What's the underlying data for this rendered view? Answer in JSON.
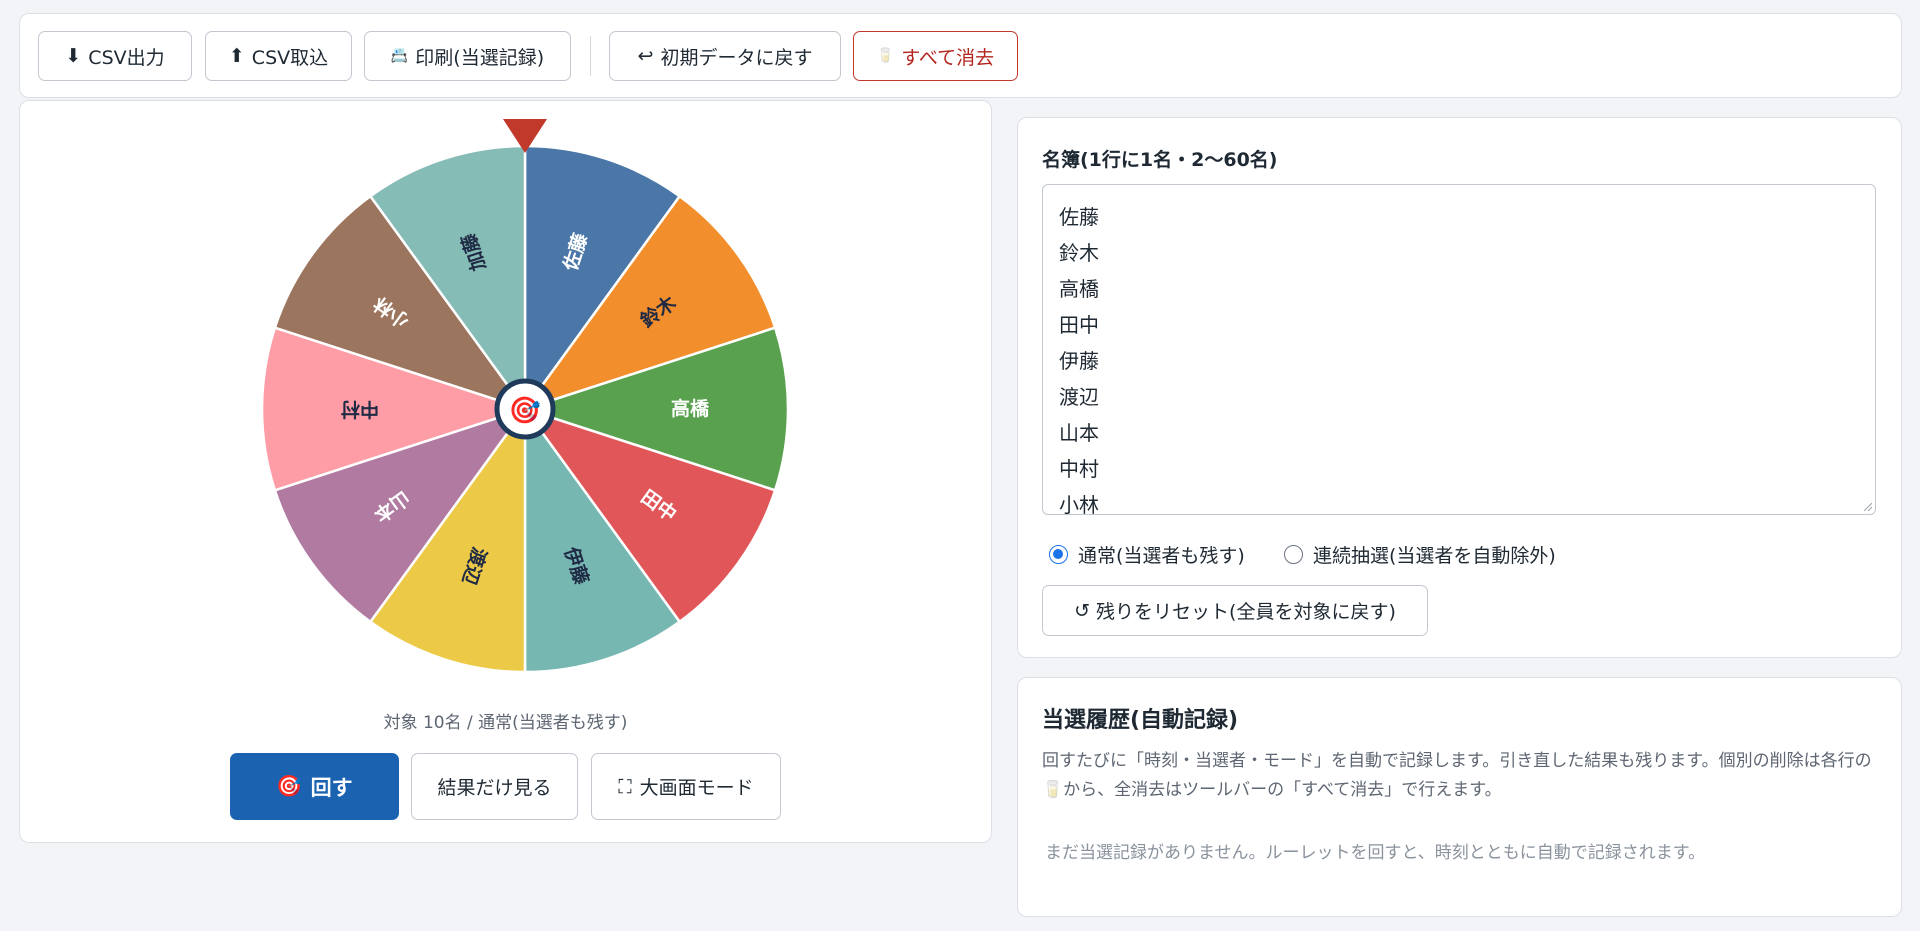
{
  "toolbar": {
    "csv_export": {
      "icon": "⬇",
      "label": "CSV出力"
    },
    "csv_import": {
      "icon": "⬆",
      "label": "CSV取込"
    },
    "print": {
      "icon": "📇",
      "label": "印刷(当選記録)"
    },
    "restore": {
      "icon": "↩",
      "label": "初期データに戻す"
    },
    "clear_all": {
      "icon": "🥛",
      "label": "すべて消去"
    }
  },
  "wheel": {
    "center_icon": "🎯",
    "pointer_color": "#c0392b",
    "segments": [
      {
        "name": "佐藤",
        "color": "#4a77a8",
        "text_color": "#ffffff"
      },
      {
        "name": "鈴木",
        "color": "#f28e2b",
        "text_color": "#1f2a44"
      },
      {
        "name": "高橋",
        "color": "#59a14f",
        "text_color": "#ffffff"
      },
      {
        "name": "田中",
        "color": "#e15759",
        "text_color": "#ffffff"
      },
      {
        "name": "伊藤",
        "color": "#76b7b2",
        "text_color": "#1f2a44"
      },
      {
        "name": "渡辺",
        "color": "#edc948",
        "text_color": "#1f2a44"
      },
      {
        "name": "山本",
        "color": "#b07aa1",
        "text_color": "#ffffff"
      },
      {
        "name": "中村",
        "color": "#ff9da7",
        "text_color": "#1f2a44"
      },
      {
        "name": "小林",
        "color": "#9c755f",
        "text_color": "#ffffff"
      },
      {
        "name": "加藤",
        "color": "#86bcb6",
        "text_color": "#1f2a44"
      }
    ]
  },
  "status": "対象 10名 / 通常(当選者も残す)",
  "actions": {
    "spin": {
      "icon": "🎯",
      "label": "回す"
    },
    "result_only": {
      "label": "結果だけ見る"
    },
    "big_screen": {
      "icon": "⛶",
      "label": "大画面モード"
    }
  },
  "roster": {
    "title": "名簿(1行に1名・2〜60名)",
    "names": [
      "佐藤",
      "鈴木",
      "高橋",
      "田中",
      "伊藤",
      "渡辺",
      "山本",
      "中村",
      "小林"
    ],
    "mode_normal": "通常(当選者も残す)",
    "mode_continuous": "連続抽選(当選者を自動除外)",
    "selected_mode": "normal",
    "reset": {
      "icon": "↺",
      "label": "残りをリセット(全員を対象に戻す)"
    }
  },
  "history": {
    "title": "当選履歴(自動記録)",
    "description": "回すたびに「時刻・当選者・モード」を自動で記録します。引き直した結果も残ります。個別の削除は各行の🥛から、全消去はツールバーの「すべて消去」で行えます。",
    "empty": "まだ当選記録がありません。ルーレットを回すと、時刻とともに自動で記録されます。"
  },
  "colors": {
    "accent": "#1b63b1",
    "danger": "#b3261e",
    "radio": "#1a73e8"
  }
}
